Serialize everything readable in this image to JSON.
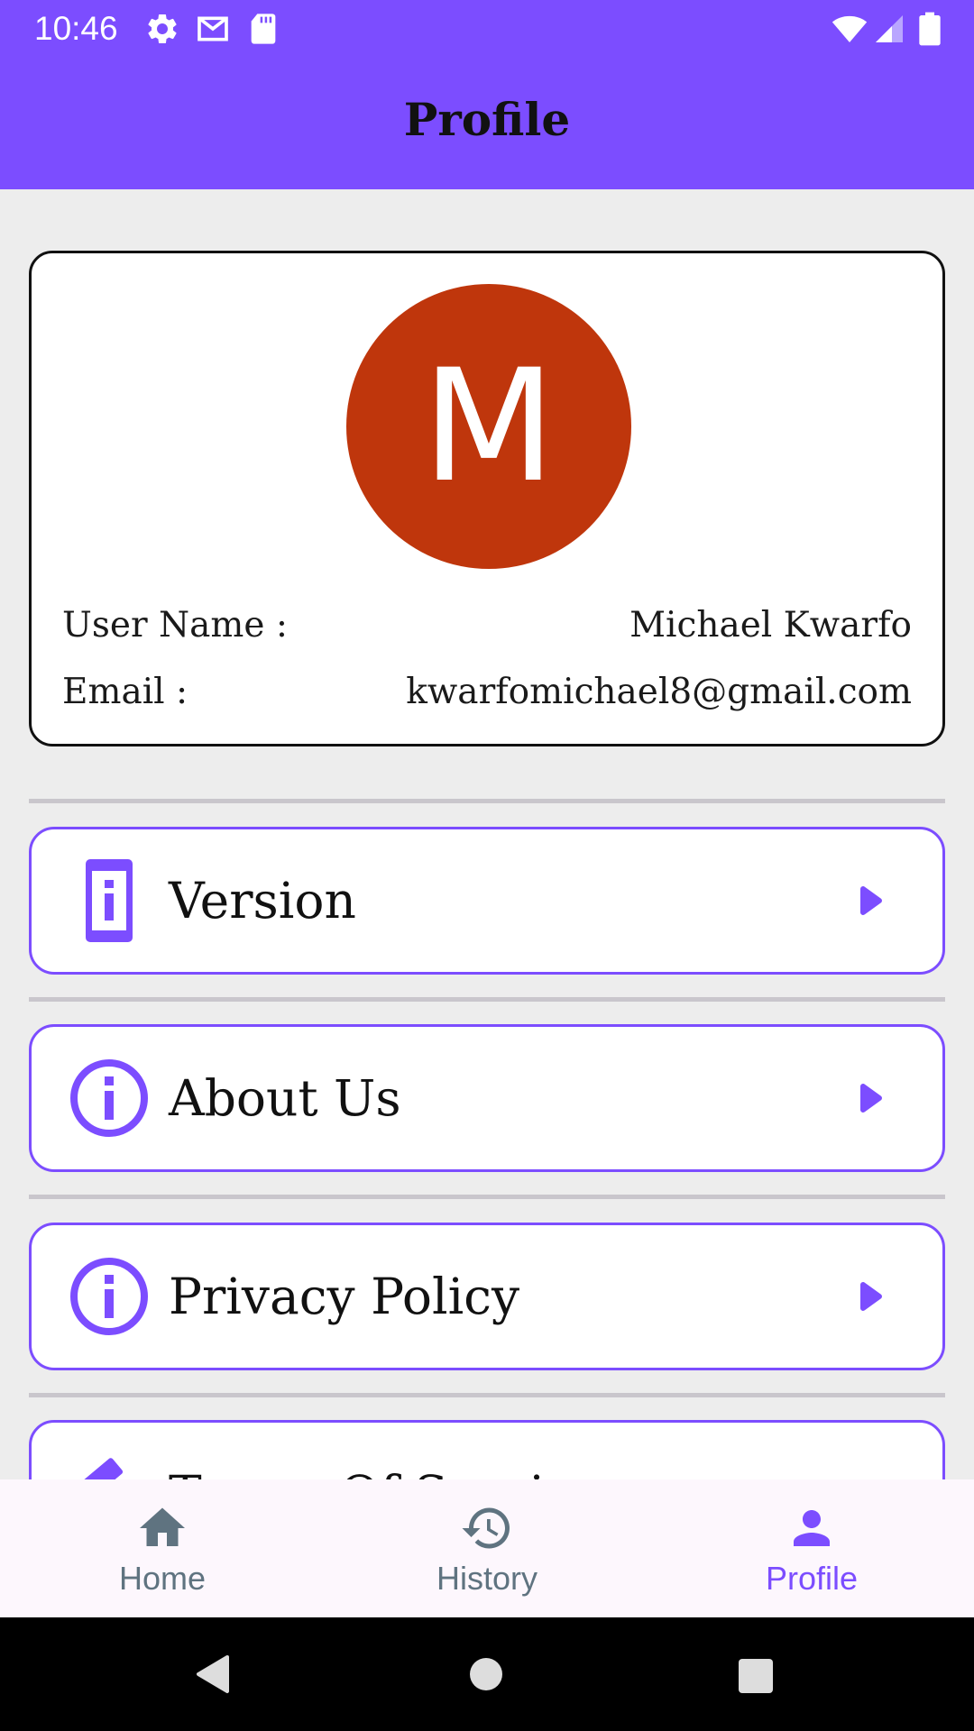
{
  "status_bar": {
    "time": "10:46",
    "left_icons": [
      "gear-icon",
      "gmail-icon",
      "sd-card-icon"
    ],
    "right_icons": [
      "wifi-icon",
      "cell-signal-icon",
      "battery-icon"
    ]
  },
  "app_bar": {
    "title": "Profile"
  },
  "profile": {
    "avatar_initial": "M",
    "avatar_color": "#bf360c",
    "username_label": "User Name :",
    "username_value": "Michael Kwarfo",
    "email_label": "Email :",
    "email_value": "kwarfomichael8@gmail.com"
  },
  "menu": [
    {
      "label": "Version",
      "icon": "phone-info-icon"
    },
    {
      "label": "About Us",
      "icon": "info-circle-icon"
    },
    {
      "label": "Privacy Policy",
      "icon": "info-circle-icon"
    },
    {
      "label": "Terms Of Service",
      "icon": "gavel-icon"
    }
  ],
  "bottom_nav": [
    {
      "label": "Home",
      "icon": "home-icon",
      "selected": false
    },
    {
      "label": "History",
      "icon": "history-icon",
      "selected": false
    },
    {
      "label": "Profile",
      "icon": "person-icon",
      "selected": true
    }
  ],
  "colors": {
    "accent": "#7c4dff",
    "nav_inactive": "#5f7380",
    "background": "#ededed"
  }
}
